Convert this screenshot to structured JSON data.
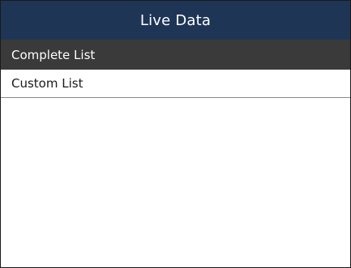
{
  "header": {
    "title": "Live Data"
  },
  "menu": {
    "items": [
      {
        "label": "Complete List",
        "selected": true
      },
      {
        "label": "Custom List",
        "selected": false
      }
    ]
  },
  "colors": {
    "title_bar": "#1e3556",
    "selected_row": "#3a3a3a",
    "background": "#ffffff"
  }
}
